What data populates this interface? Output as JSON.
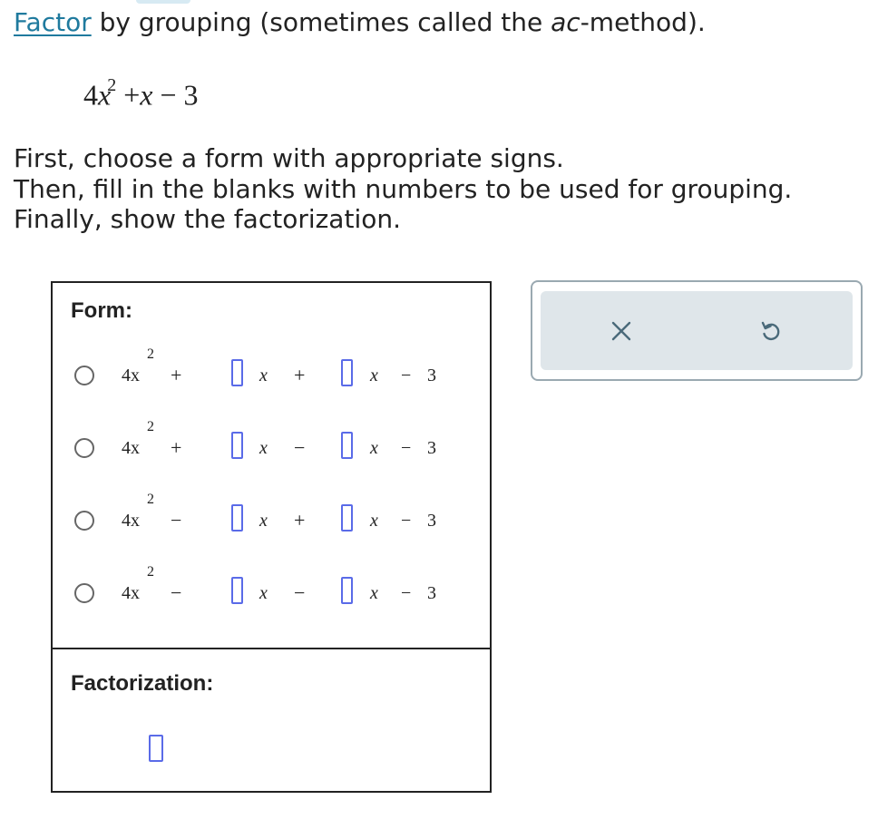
{
  "prompt": {
    "link": "Factor",
    "text_before_ac": " by grouping (sometimes called the ",
    "ac": "ac",
    "text_after_ac": "-method)."
  },
  "polynomial": {
    "coef": "4",
    "var": "x",
    "exp": "2",
    "rest_op1": "+",
    "rest_var": "x",
    "rest_op2": "−",
    "rest_const": "3"
  },
  "instructions": [
    "First, choose a form with appropriate signs.",
    "Then, fill in the blanks with numbers to be used for grouping.",
    "Finally, show the factorization."
  ],
  "form_section": {
    "title": "Form:",
    "options": [
      {
        "lead": "4x",
        "exp": "2",
        "sign1": "+",
        "var1": "x",
        "sign2": "+",
        "var2": "x",
        "sign3": "−",
        "const": "3"
      },
      {
        "lead": "4x",
        "exp": "2",
        "sign1": "+",
        "var1": "x",
        "sign2": "−",
        "var2": "x",
        "sign3": "−",
        "const": "3"
      },
      {
        "lead": "4x",
        "exp": "2",
        "sign1": "−",
        "var1": "x",
        "sign2": "+",
        "var2": "x",
        "sign3": "−",
        "const": "3"
      },
      {
        "lead": "4x",
        "exp": "2",
        "sign1": "−",
        "var1": "x",
        "sign2": "−",
        "var2": "x",
        "sign3": "−",
        "const": "3"
      }
    ]
  },
  "factorization_section": {
    "title": "Factorization:"
  },
  "tools": {
    "clear_icon": "close-icon",
    "undo_icon": "undo-icon",
    "icon_color": "#4a6a7a",
    "panel_bg": "#dfe6ea"
  },
  "colors": {
    "link": "#1f7a9e",
    "blank_border": "#5a6be8"
  }
}
